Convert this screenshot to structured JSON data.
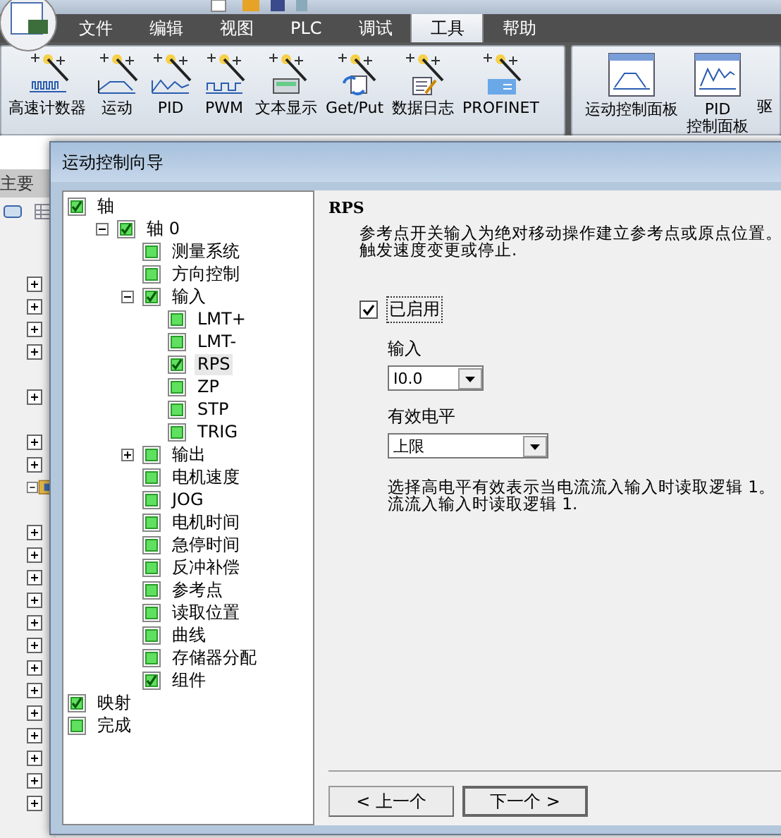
{
  "menu_tabs": [
    {
      "label": "文件",
      "selected": false
    },
    {
      "label": "编辑",
      "selected": false
    },
    {
      "label": "视图",
      "selected": false
    },
    {
      "label": "PLC",
      "selected": false
    },
    {
      "label": "调试",
      "selected": false
    },
    {
      "label": "工具",
      "selected": true
    },
    {
      "label": "帮助",
      "selected": false
    }
  ],
  "ribbon_groups": [
    {
      "buttons": [
        {
          "label": "高速计数器",
          "kind": "pulses"
        },
        {
          "label": "运动",
          "kind": "ramp"
        },
        {
          "label": "PID",
          "kind": "wave"
        },
        {
          "label": "PWM",
          "kind": "square"
        },
        {
          "label": "文本显示",
          "kind": "display"
        },
        {
          "label": "Get/Put",
          "kind": "exchange"
        },
        {
          "label": "数据日志",
          "kind": "log"
        },
        {
          "label": "PROFINET",
          "kind": "network"
        }
      ]
    },
    {
      "buttons": [
        {
          "label": "运动控制面板",
          "kind": "ramp-panel"
        },
        {
          "label": "PID\n控制面板",
          "kind": "wave-panel"
        },
        {
          "label": "驱",
          "kind": "cut"
        }
      ]
    }
  ],
  "side_panel": {
    "header": "主要",
    "nodes": [
      {
        "kind": "node",
        "expanded": false
      },
      {
        "kind": "node",
        "expanded": false
      },
      {
        "kind": "node",
        "expanded": false
      },
      {
        "kind": "node",
        "expanded": false
      },
      {
        "kind": "line"
      },
      {
        "kind": "node",
        "expanded": false
      },
      {
        "kind": "line"
      },
      {
        "kind": "node",
        "expanded": false
      },
      {
        "kind": "node",
        "expanded": false
      },
      {
        "kind": "folder",
        "expanded": true
      },
      {
        "kind": "line"
      },
      {
        "kind": "node",
        "expanded": false
      },
      {
        "kind": "node",
        "expanded": false
      },
      {
        "kind": "node",
        "expanded": false
      },
      {
        "kind": "node",
        "expanded": false
      },
      {
        "kind": "node",
        "expanded": false
      },
      {
        "kind": "node",
        "expanded": false
      },
      {
        "kind": "node",
        "expanded": false
      },
      {
        "kind": "node",
        "expanded": false
      },
      {
        "kind": "node",
        "expanded": false
      },
      {
        "kind": "node",
        "expanded": false
      },
      {
        "kind": "node",
        "expanded": false
      },
      {
        "kind": "node",
        "expanded": false
      },
      {
        "kind": "node",
        "expanded": false
      }
    ]
  },
  "dialog": {
    "title": "运动控制向导",
    "tree": [
      {
        "label": "轴",
        "checked": true,
        "selected": false,
        "children": [
          {
            "label": "轴 0",
            "checked": true,
            "selected": false,
            "expanded": true,
            "children": [
              {
                "label": "测量系统",
                "checked": false,
                "selected": false
              },
              {
                "label": "方向控制",
                "checked": false,
                "selected": false
              },
              {
                "label": "输入",
                "checked": true,
                "selected": false,
                "expanded": true,
                "children": [
                  {
                    "label": "LMT+",
                    "checked": false,
                    "selected": false
                  },
                  {
                    "label": "LMT-",
                    "checked": false,
                    "selected": false
                  },
                  {
                    "label": "RPS",
                    "checked": true,
                    "selected": true
                  },
                  {
                    "label": "ZP",
                    "checked": false,
                    "selected": false
                  },
                  {
                    "label": "STP",
                    "checked": false,
                    "selected": false
                  },
                  {
                    "label": "TRIG",
                    "checked": false,
                    "selected": false
                  }
                ]
              },
              {
                "label": "输出",
                "checked": false,
                "selected": false,
                "expanded": false
              },
              {
                "label": "电机速度",
                "checked": false,
                "selected": false
              },
              {
                "label": "JOG",
                "checked": false,
                "selected": false
              },
              {
                "label": "电机时间",
                "checked": false,
                "selected": false
              },
              {
                "label": "急停时间",
                "checked": false,
                "selected": false
              },
              {
                "label": "反冲补偿",
                "checked": false,
                "selected": false
              },
              {
                "label": "参考点",
                "checked": false,
                "selected": false
              },
              {
                "label": "读取位置",
                "checked": false,
                "selected": false
              },
              {
                "label": "曲线",
                "checked": false,
                "selected": false
              },
              {
                "label": "存储器分配",
                "checked": false,
                "selected": false
              },
              {
                "label": "组件",
                "checked": true,
                "selected": false
              }
            ]
          }
        ]
      },
      {
        "label": "映射",
        "checked": true,
        "selected": false
      },
      {
        "label": "完成",
        "checked": false,
        "selected": false
      }
    ],
    "page": {
      "heading": "RPS",
      "description": [
        "参考点开关输入为绝对移动操作建立参考点或原点位置。",
        "触发速度变更或停止."
      ],
      "enabled": {
        "label": "已启用",
        "checked": true
      },
      "input": {
        "label": "输入",
        "value": "I0.0"
      },
      "active_level": {
        "label": "有效电平",
        "value": "上限"
      },
      "note": [
        "选择高电平有效表示当电流流入输入时读取逻辑 1。",
        "流流入输入时读取逻辑 1."
      ]
    },
    "buttons": [
      {
        "label": "< 上一个",
        "kind": "back"
      },
      {
        "label": "下一个 >",
        "kind": "next"
      }
    ]
  }
}
